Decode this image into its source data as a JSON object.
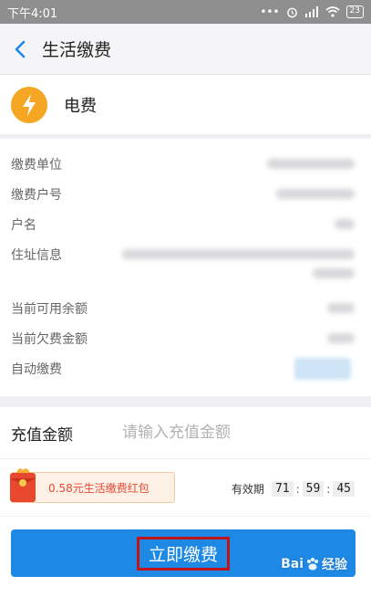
{
  "status_bar": {
    "time": "下午4:01",
    "battery": "23"
  },
  "nav": {
    "title": "生活缴费"
  },
  "provider": {
    "name": "电费"
  },
  "info_rows": [
    {
      "label": "缴费单位"
    },
    {
      "label": "缴费户号"
    },
    {
      "label": "户名"
    },
    {
      "label": "住址信息"
    },
    {
      "label": "当前可用余额"
    },
    {
      "label": "当前欠费金额"
    },
    {
      "label": "自动缴费"
    }
  ],
  "recharge": {
    "label": "充值金额",
    "placeholder": "请输入充值金额",
    "value": ""
  },
  "coupon": {
    "text": "0.58元生活缴费红包",
    "expiry_label": "有效期",
    "hours": "71",
    "minutes": "59",
    "seconds": "45"
  },
  "pay": {
    "label": "立即缴费"
  },
  "watermark": {
    "text": "Bai",
    "suffix": "经验"
  },
  "colors": {
    "accent": "#1e88e5",
    "highlight": "#c0141c",
    "bolt": "#f5a623",
    "coupon": "#e44a3a"
  }
}
